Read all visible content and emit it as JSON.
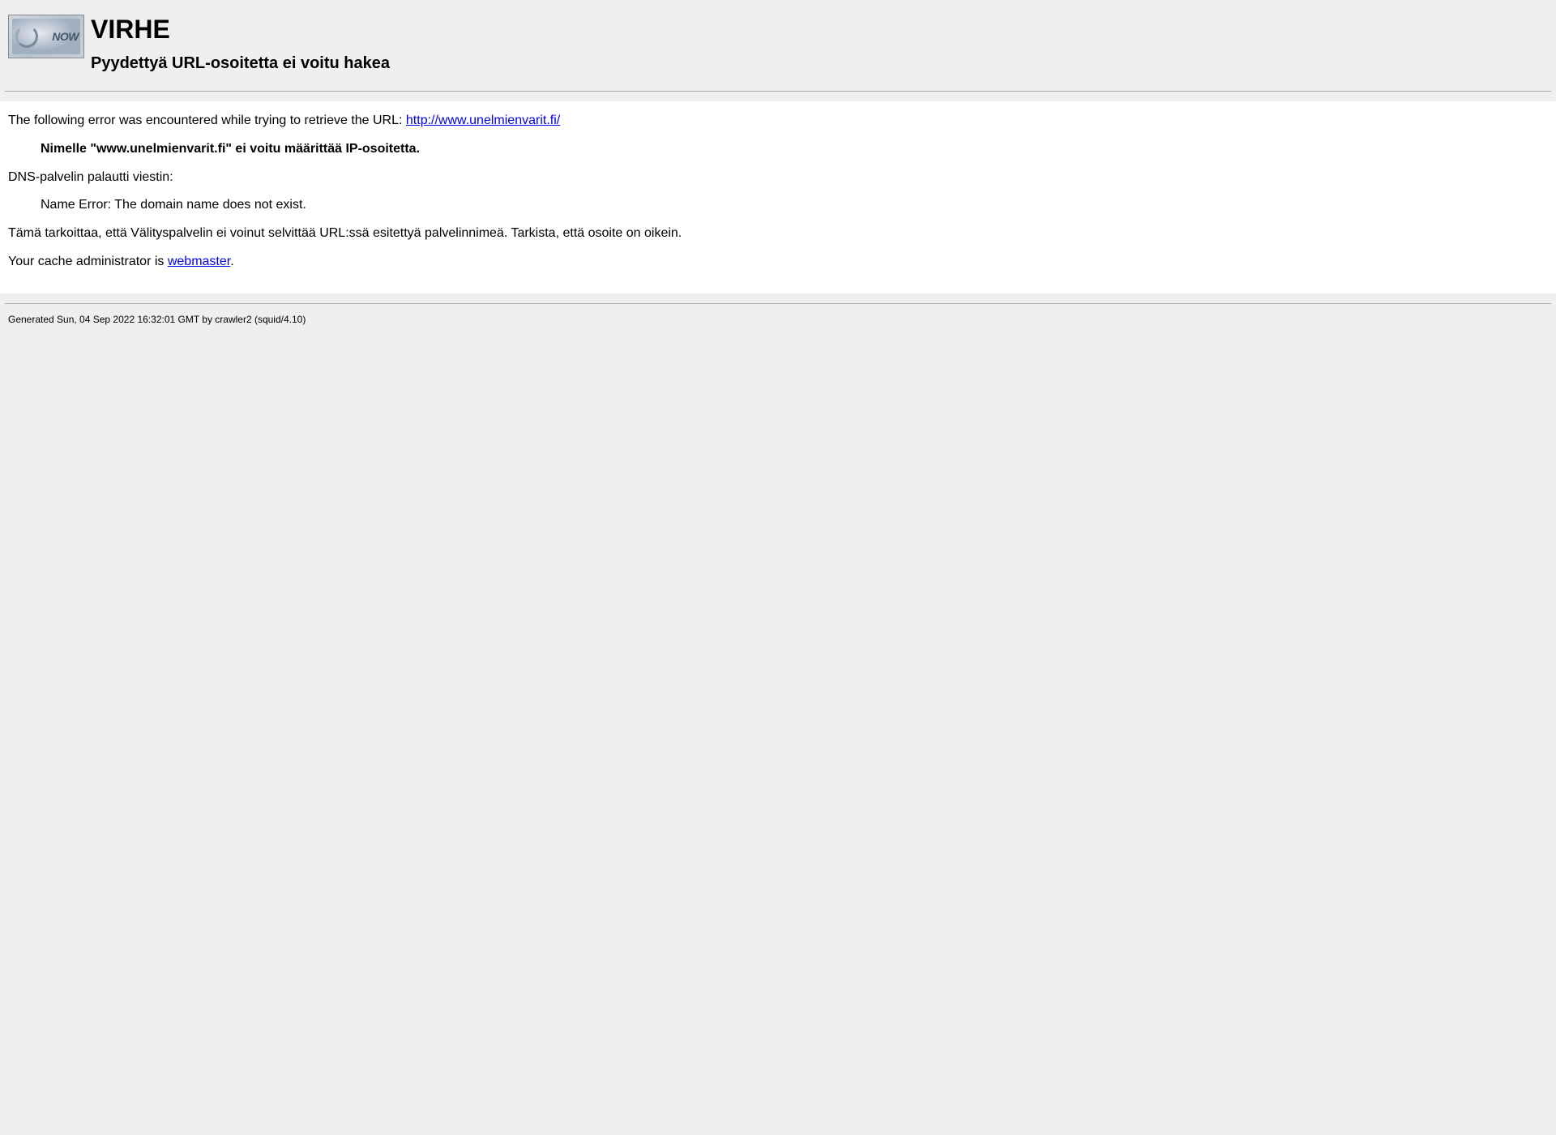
{
  "header": {
    "title": "VIRHE",
    "subtitle": "Pyydettyä URL-osoitetta ei voitu hakea",
    "logo_text": "NOW"
  },
  "content": {
    "error_intro": "The following error was encountered while trying to retrieve the URL: ",
    "url": "http://www.unelmienvarit.fi/",
    "error_detail": "Nimelle \"www.unelmienvarit.fi\" ei voitu määrittää IP-osoitetta.",
    "dns_intro": "DNS-palvelin palautti viestin:",
    "dns_message": "Name Error: The domain name does not exist.",
    "explanation": "Tämä tarkoittaa, että Välityspalvelin ei voinut selvittää URL:ssä esitettyä palvelinnimeä. Tarkista, että osoite on oikein.",
    "admin_intro": "Your cache administrator is ",
    "admin_link": "webmaster",
    "admin_suffix": "."
  },
  "footer": {
    "generated": "Generated Sun, 04 Sep 2022 16:32:01 GMT by crawler2 (squid/4.10)"
  }
}
